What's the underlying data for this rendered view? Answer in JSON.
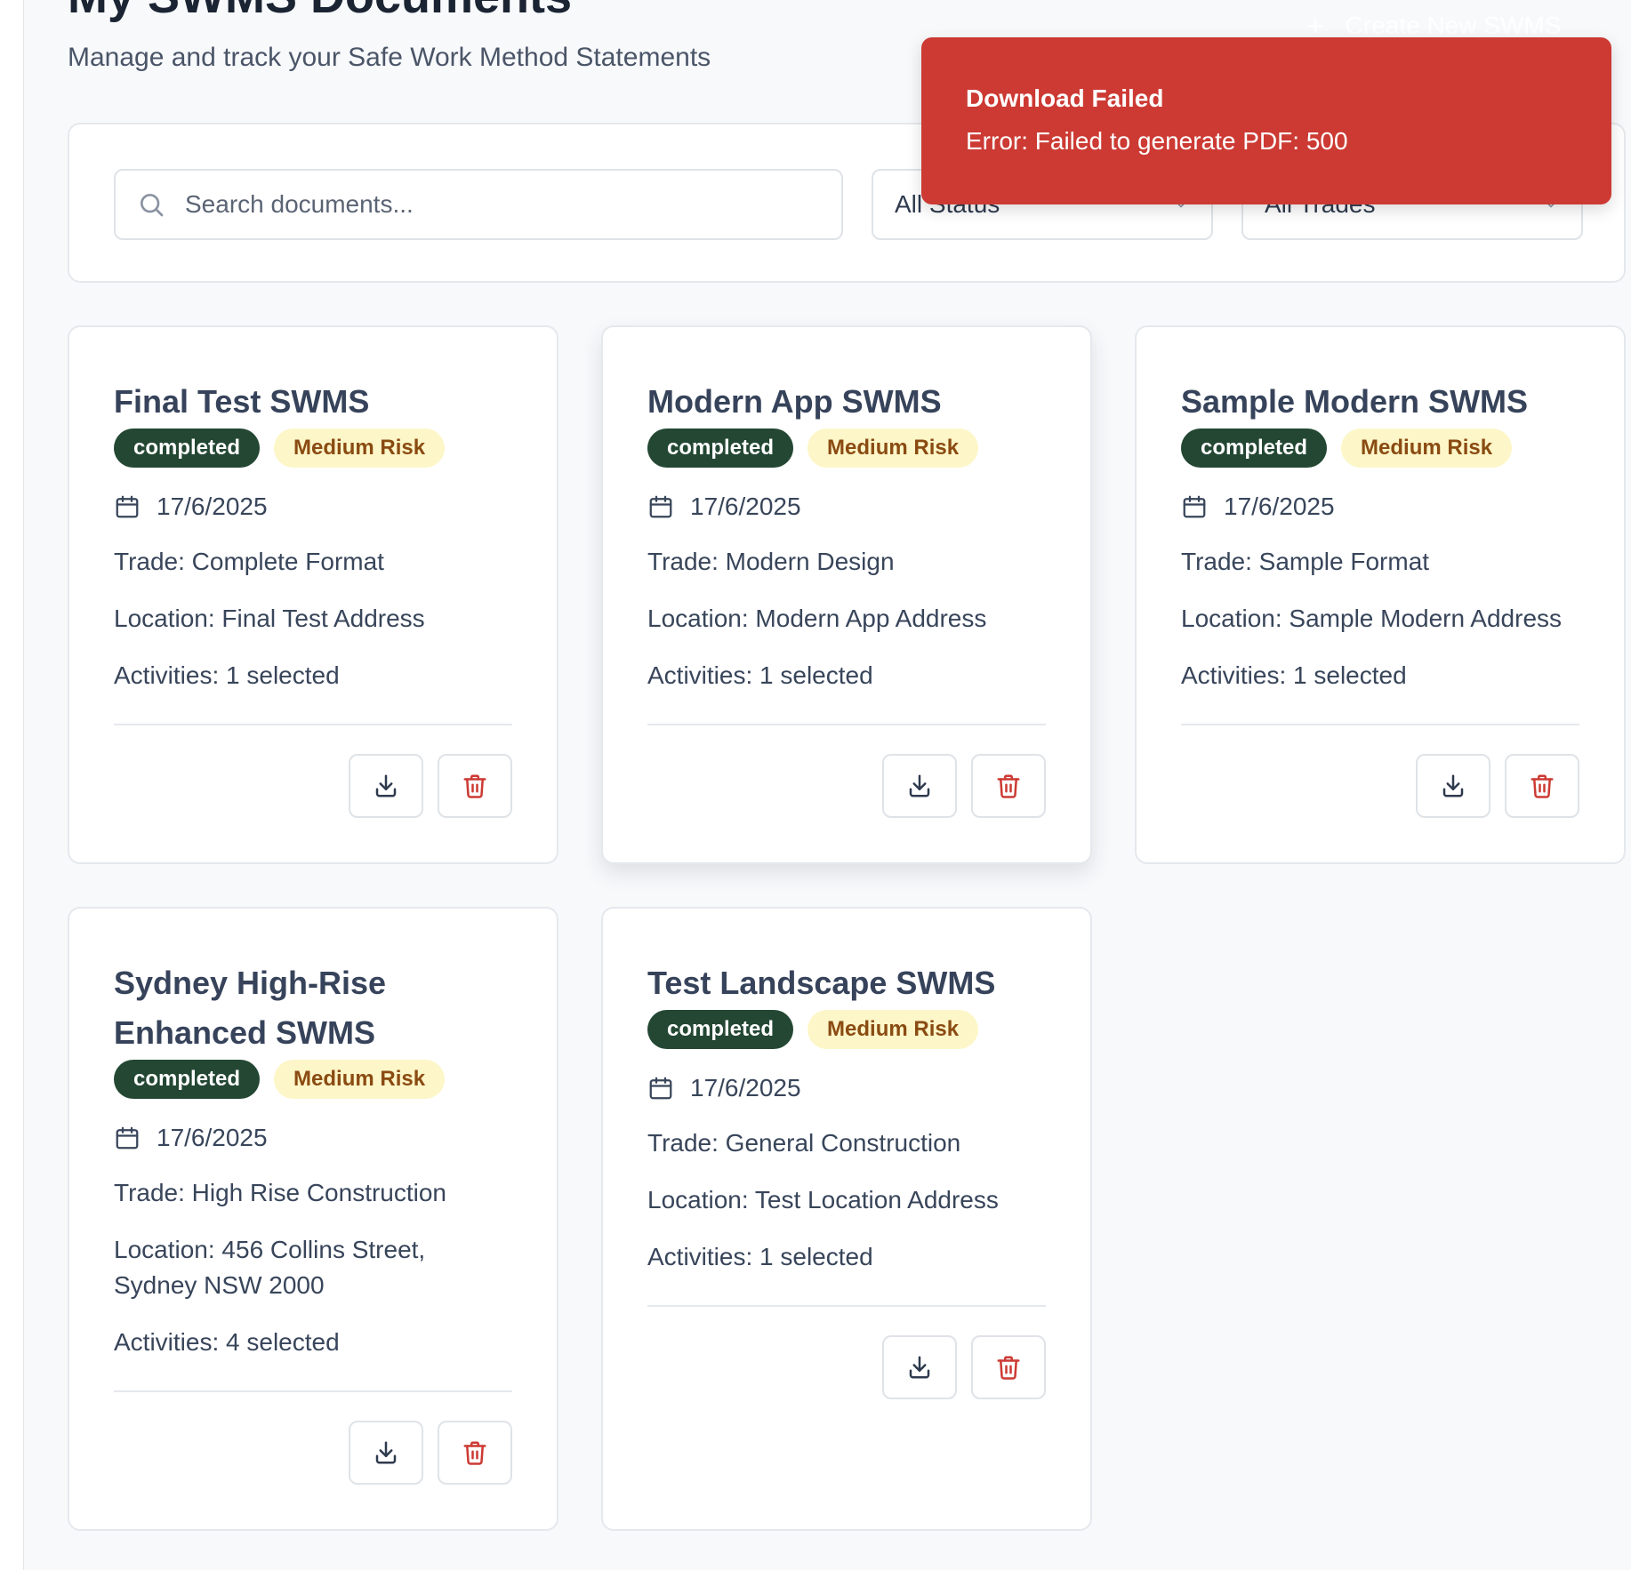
{
  "header": {
    "title": "My SWMS Documents",
    "subtitle": "Manage and track your Safe Work Method Statements",
    "create_button_label": "Create New SWMS"
  },
  "filters": {
    "search_placeholder": "Search documents...",
    "status_select_value": "All Status",
    "trades_select_value": "All Trades"
  },
  "toast": {
    "title": "Download Failed",
    "message": "Error: Failed to generate PDF: 500",
    "color": "#cc3a33"
  },
  "colors": {
    "status_badge_bg": "#234733",
    "risk_badge_bg": "#fdf6c8",
    "risk_badge_text": "#8a4b12",
    "delete_icon": "#cc3a33"
  },
  "documents": [
    {
      "title": "Final Test SWMS",
      "status": "completed",
      "risk": "Medium Risk",
      "date": "17/6/2025",
      "trade": "Trade: Complete Format",
      "location": "Location: Final Test Address",
      "activities": "Activities: 1 selected"
    },
    {
      "title": "Modern App SWMS",
      "status": "completed",
      "risk": "Medium Risk",
      "date": "17/6/2025",
      "trade": "Trade: Modern Design",
      "location": "Location: Modern App Address",
      "activities": "Activities: 1 selected"
    },
    {
      "title": "Sample Modern SWMS",
      "status": "completed",
      "risk": "Medium Risk",
      "date": "17/6/2025",
      "trade": "Trade: Sample Format",
      "location": "Location: Sample Modern Address",
      "activities": "Activities: 1 selected"
    },
    {
      "title": "Sydney High-Rise Enhanced SWMS",
      "status": "completed",
      "risk": "Medium Risk",
      "date": "17/6/2025",
      "trade": "Trade: High Rise Construction",
      "location": "Location: 456 Collins Street, Sydney NSW 2000",
      "activities": "Activities: 4 selected"
    },
    {
      "title": "Test Landscape SWMS",
      "status": "completed",
      "risk": "Medium Risk",
      "date": "17/6/2025",
      "trade": "Trade: General Construction",
      "location": "Location: Test Location Address",
      "activities": "Activities: 1 selected"
    }
  ]
}
